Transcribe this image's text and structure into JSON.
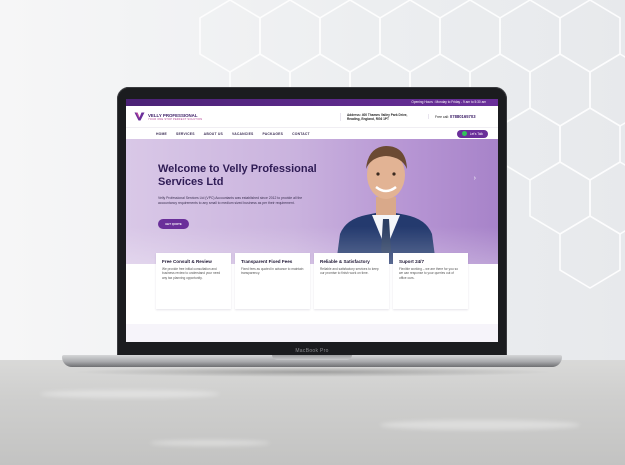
{
  "site": {
    "topbar_hours": "Opening Hours : Monday to Friday - 9 am to 5:30 am",
    "logo_title": "VELLY PROFESSIONAL",
    "logo_tagline": "YOUR ONE STOP PERFECT SOLUTION",
    "address": "Address: 400 Thames Valley Park Drive, Reading, England, RG6 1PT",
    "call_label": "Free call:",
    "call_number": "07880165703",
    "nav": [
      "HOME",
      "SERVICES",
      "ABOUT US",
      "VACANCIES",
      "PACKAGES",
      "CONTACT"
    ],
    "talk_label": "Let's Talk",
    "hero_title": "Welcome to Velly Professional Services Ltd",
    "hero_text": "Velly Professional Services Ltd (VPC) Accountants was established since 2012 to provide all the accountancy requirements to any small to medium sized business as per their requirement.",
    "quote_label": "GET QUOTE",
    "cards": [
      {
        "title": "Free Consult & Review",
        "text": "We provide free initial consultation and business review to understand your need any tax planning opportunity."
      },
      {
        "title": "Transparent Fixed Fees",
        "text": "Fixed fees as quoted in advance to maintain transparency."
      },
      {
        "title": "Reliable & Satisfactory",
        "text": "Reliable and satisfactory services to keep our promise to finish work on time."
      },
      {
        "title": "Suport 24/7",
        "text": "Flexible working – we are there for you so we can response to your queries out of office ours."
      }
    ]
  },
  "device": {
    "brand_label": "MacBook Pro"
  },
  "colors": {
    "brand_purple": "#6a2f9a",
    "brand_dark": "#2f1c55",
    "accent_pink": "#b0378e"
  }
}
